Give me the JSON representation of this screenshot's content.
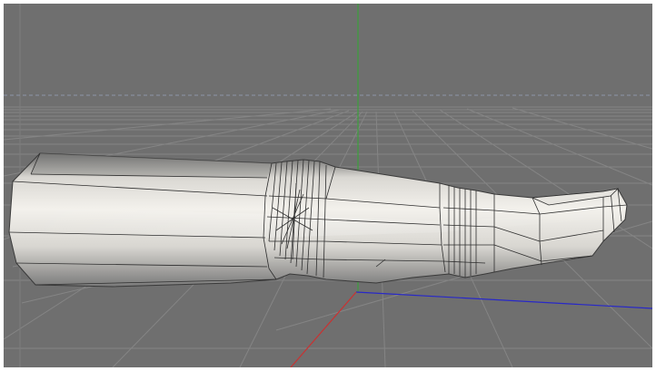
{
  "viewport": {
    "background_color": "#6f6f6f",
    "grid_color": "#8a8a8a",
    "axis_colors": {
      "x": "#c83232",
      "y": "#3ca03c",
      "z": "#2828c8"
    },
    "horizon_line_color": "#8c96a8",
    "model_fill_light": "#f2f0ec",
    "model_fill_dark": "#5a5a5a",
    "wireframe_color": "#2a2a2a"
  }
}
